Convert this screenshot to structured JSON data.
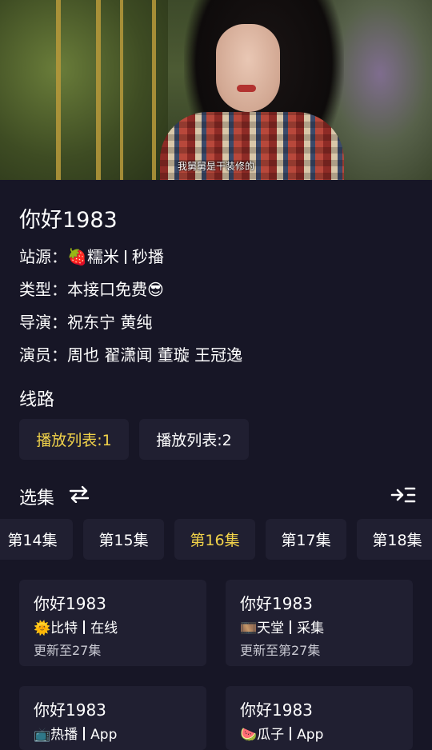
{
  "video": {
    "subtitle": "我舅舅是干装修的"
  },
  "detail": {
    "title": "你好1983",
    "source_label": "站源：",
    "source_emoji": "🍓",
    "source_name": "糯米",
    "source_type": "秒播",
    "category": "类型：本接口免费😎",
    "director": "导演：祝东宁 黄纯",
    "actors": "演员：周也 翟潇闻 董璇 王冠逸"
  },
  "routes": {
    "heading": "线路",
    "items": [
      {
        "label": "播放列表:1",
        "active": true
      },
      {
        "label": "播放列表:2",
        "active": false
      }
    ]
  },
  "episodes": {
    "heading": "选集",
    "items": [
      {
        "label": "第14集",
        "active": false
      },
      {
        "label": "第15集",
        "active": false
      },
      {
        "label": "第16集",
        "active": true
      },
      {
        "label": "第17集",
        "active": false
      },
      {
        "label": "第18集",
        "active": false
      }
    ]
  },
  "sources": [
    {
      "title": "你好1983",
      "emoji": "🌞",
      "name": "比特",
      "type": "在线",
      "update": "更新至27集"
    },
    {
      "title": "你好1983",
      "emoji": "🎞️",
      "name": "天堂",
      "type": "采集",
      "update": "更新至第27集"
    },
    {
      "title": "你好1983",
      "emoji": "📺",
      "name": "热播",
      "type": "App",
      "update": ""
    },
    {
      "title": "你好1983",
      "emoji": "🍉",
      "name": "瓜子",
      "type": "App",
      "update": ""
    }
  ],
  "colors": {
    "background": "#171626",
    "card": "#201f31",
    "accent": "#f2d34a"
  },
  "icons": [
    "swap-icon",
    "indent-icon"
  ]
}
